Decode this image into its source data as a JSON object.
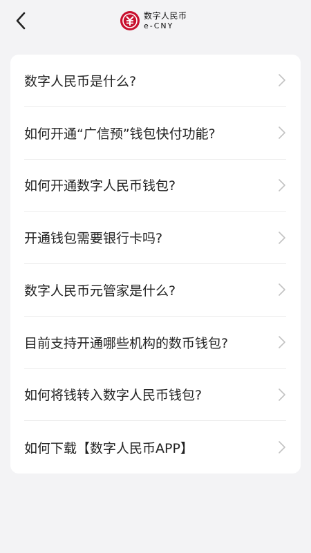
{
  "header": {
    "logo_cn": "数字人民币",
    "logo_en": "e-CNY"
  },
  "faq": {
    "items": [
      {
        "label": "数字人民币是什么?"
      },
      {
        "label": "如何开通“广信预”钱包快付功能?"
      },
      {
        "label": "如何开通数字人民币钱包?"
      },
      {
        "label": "开通钱包需要银行卡吗?"
      },
      {
        "label": "数字人民币元管家是什么?"
      },
      {
        "label": "目前支持开通哪些机构的数币钱包?"
      },
      {
        "label": "如何将钱转入数字人民币钱包?"
      },
      {
        "label": "如何下载【数字人民币APP】"
      }
    ]
  },
  "colors": {
    "brand_red": "#c8102e",
    "background": "#f3f3f5",
    "card": "#ffffff"
  }
}
